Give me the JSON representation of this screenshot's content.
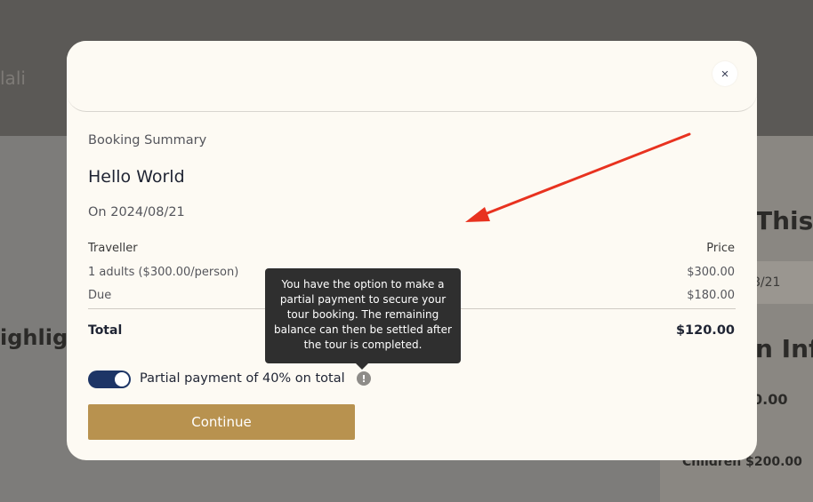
{
  "background": {
    "brand_partial": "lali",
    "highlights_partial": "ighlig",
    "title_partial": "This",
    "date_partial": "8/21",
    "info_partial": "n Inf",
    "price_partial": "0.00",
    "children_line": "Children $200.00"
  },
  "modal": {
    "close_glyph": "×",
    "summary_label": "Booking Summary",
    "tour_title": "Hello World",
    "tour_date": "On 2024/08/21",
    "columns": {
      "traveller": "Traveller",
      "price": "Price"
    },
    "rows": [
      {
        "label": "1 adults ($300.00/person)",
        "value": "$300.00"
      },
      {
        "label": "Due",
        "value": "$180.00"
      }
    ],
    "total": {
      "label": "Total",
      "value": "$120.00"
    },
    "partial_payment": {
      "label": "Partial payment of 40% on total",
      "enabled": true,
      "info_glyph": "!"
    },
    "continue_label": "Continue",
    "tooltip": "You have the option to make a partial payment to secure your tour booking. The remaining balance can then be settled after the tour is completed."
  },
  "colors": {
    "accent_gold": "#b8924f",
    "toggle_navy": "#1d3566",
    "annotation_red": "#e8321f",
    "modal_bg": "#fdfaf3"
  }
}
